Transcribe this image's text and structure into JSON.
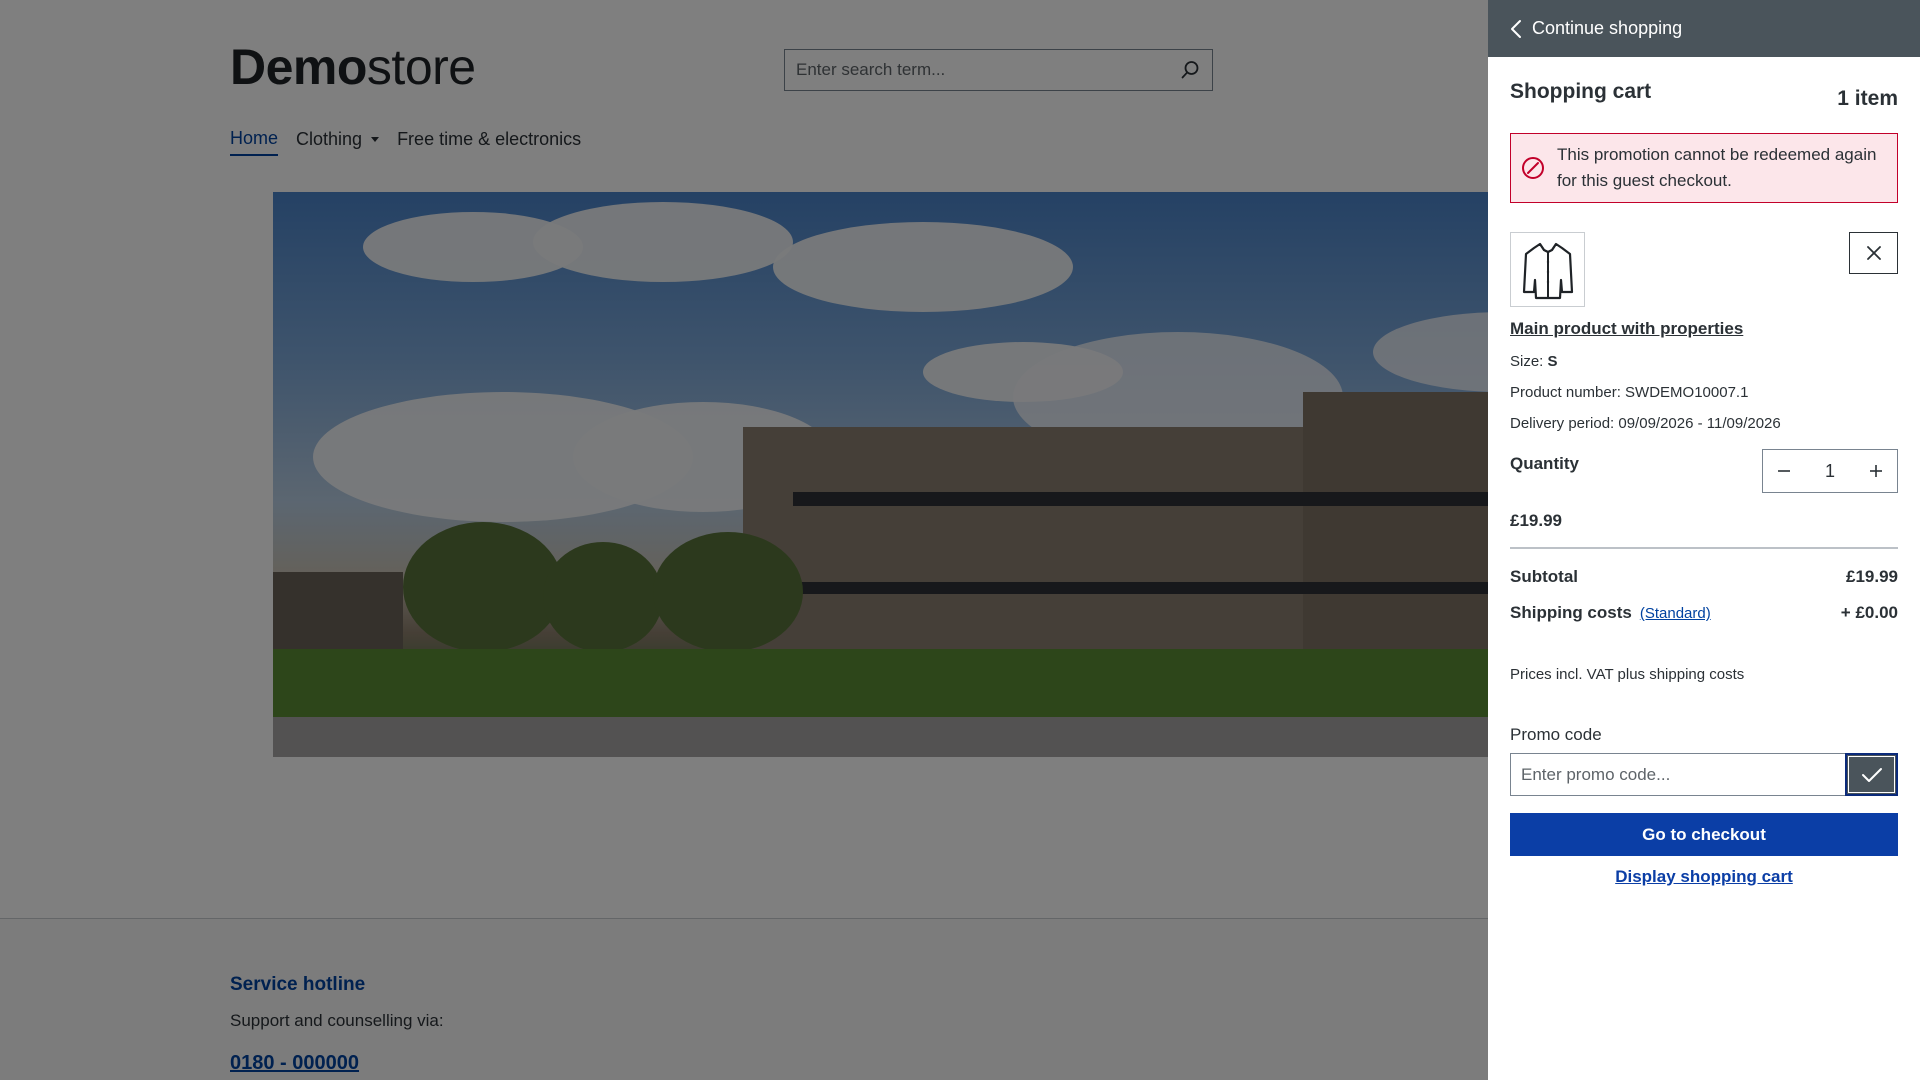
{
  "header": {
    "logo_bold": "Demo",
    "logo_light": "store",
    "search_placeholder": "Enter search term..."
  },
  "nav": {
    "items": [
      {
        "label": "Home",
        "active": true
      },
      {
        "label": "Clothing",
        "has_dropdown": true
      },
      {
        "label": "Free time & electronics"
      }
    ]
  },
  "footer": {
    "heading": "Service hotline",
    "subtext": "Support and counselling via:",
    "phone": "0180 - 000000"
  },
  "cart": {
    "back_label": "Continue shopping",
    "title": "Shopping cart",
    "count": "1 item",
    "alert_text": "This promotion cannot be redeemed again for this guest checkout.",
    "item": {
      "name": "Main product with properties",
      "size_label": "Size:",
      "size_value": "S",
      "product_number": "Product number: SWDEMO10007.1",
      "delivery": "Delivery period: 09/09/2026 - 11/09/2026",
      "quantity_label": "Quantity",
      "quantity": "1",
      "price": "£19.99"
    },
    "subtotal_label": "Subtotal",
    "subtotal_value": "£19.99",
    "shipping_label": "Shipping costs",
    "shipping_link": "(Standard)",
    "shipping_value": "+ £0.00",
    "vat_note": "Prices incl. VAT plus shipping costs",
    "promo_label": "Promo code",
    "promo_placeholder": "Enter promo code...",
    "checkout_label": "Go to checkout",
    "display_cart_label": "Display shopping cart"
  },
  "colors": {
    "primary": "#0b3ea6",
    "header_bar": "#4a545b",
    "alert_border": "#c2002a",
    "alert_bg": "#fce6ea"
  }
}
